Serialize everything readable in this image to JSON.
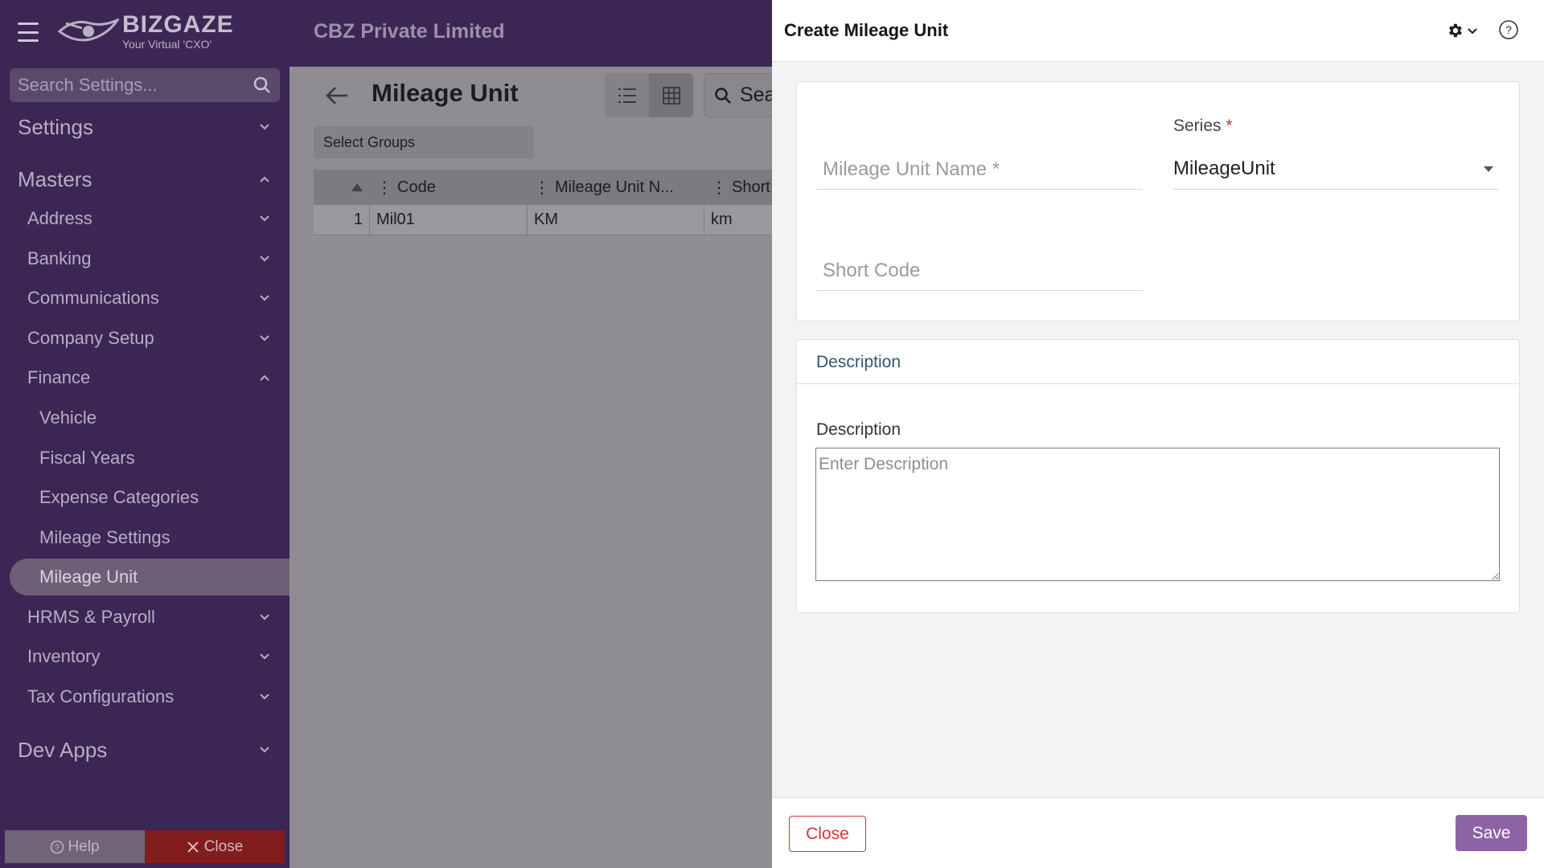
{
  "header": {
    "logo_text": "BIZGAZE",
    "logo_tagline": "Your Virtual 'CXO'",
    "company_name": "CBZ Private Limited"
  },
  "sidebar": {
    "search_placeholder": "Search Settings...",
    "items": [
      {
        "label": "Settings",
        "level": 1,
        "expanded": false
      },
      {
        "label": "Masters",
        "level": 1,
        "expanded": true
      },
      {
        "label": "Address",
        "level": 2,
        "expanded": false
      },
      {
        "label": "Banking",
        "level": 2,
        "expanded": false
      },
      {
        "label": "Communications",
        "level": 2,
        "expanded": false
      },
      {
        "label": "Company Setup",
        "level": 2,
        "expanded": false
      },
      {
        "label": "Finance",
        "level": 2,
        "expanded": true
      },
      {
        "label": "Vehicle",
        "level": 3
      },
      {
        "label": "Fiscal Years",
        "level": 3
      },
      {
        "label": "Expense Categories",
        "level": 3
      },
      {
        "label": "Mileage Settings",
        "level": 3
      },
      {
        "label": "Mileage Unit",
        "level": 3,
        "active": true
      },
      {
        "label": "HRMS & Payroll",
        "level": 2,
        "expanded": false
      },
      {
        "label": "Inventory",
        "level": 2,
        "expanded": false
      },
      {
        "label": "Tax Configurations",
        "level": 2,
        "expanded": false
      },
      {
        "label": "Dev Apps",
        "level": 1,
        "expanded": false
      }
    ],
    "help_label": "Help",
    "close_label": "Close"
  },
  "main": {
    "title": "Mileage Unit",
    "search_text": "Sea",
    "select_groups": "Select Groups",
    "columns": [
      "Code",
      "Mileage Unit N...",
      "Short"
    ],
    "rows": [
      {
        "num": "1",
        "code": "Mil01",
        "name": "KM",
        "short": "km"
      }
    ]
  },
  "drawer": {
    "title": "Create Mileage Unit",
    "mileage_unit_name_placeholder": "Mileage Unit Name *",
    "series_label": "Series",
    "series_required": "*",
    "series_value": "MileageUnit",
    "short_code_placeholder": "Short Code",
    "description_section_title": "Description",
    "description_label": "Description",
    "description_placeholder": "Enter Description",
    "close_label": "Close",
    "save_label": "Save"
  },
  "colors": {
    "sidebar_bg": "#3c2754",
    "save_button": "#8e63a6",
    "close_button_border": "#d13636",
    "sidebar_close_bg": "#821d1d"
  }
}
